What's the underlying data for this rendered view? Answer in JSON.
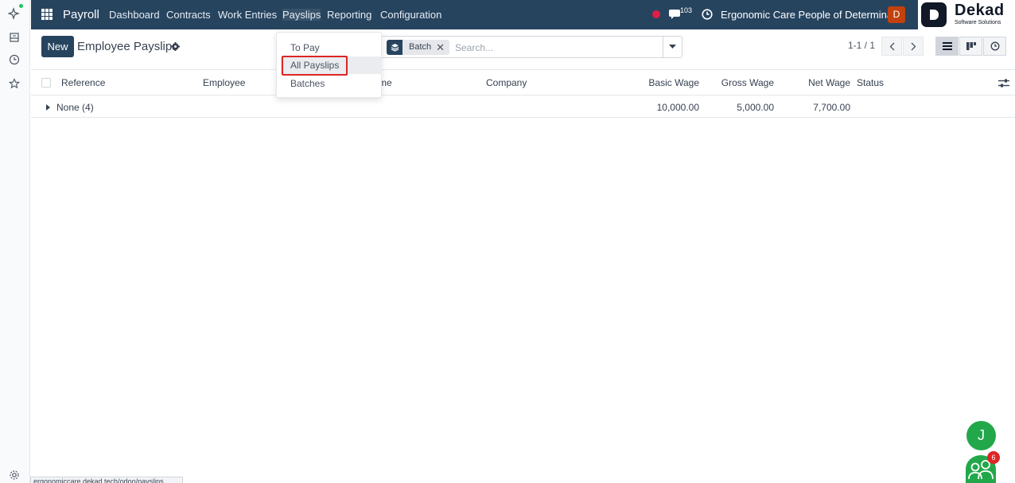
{
  "topbar": {
    "app_name": "Payroll",
    "menu": [
      "Dashboard",
      "Contracts",
      "Work Entries",
      "Payslips",
      "Reporting",
      "Configuration"
    ],
    "active_menu": "Payslips",
    "messages_count": "103",
    "company": "Ergonomic Care People of Determina...",
    "user_initial": "D",
    "colors": {
      "bar": "#27445f",
      "avatar": "#c2410c",
      "status_dot": "#e11d48"
    }
  },
  "logo": {
    "name": "Dekad",
    "tagline": "Software Solutions"
  },
  "control_panel": {
    "new_label": "New",
    "title": "Employee Payslips",
    "facet_label": "Batch",
    "facet_remove": "✕",
    "search_placeholder": "Search...",
    "pager": "1-1 / 1"
  },
  "payslips_menu": {
    "items": [
      "To Pay",
      "All Payslips",
      "Batches"
    ],
    "selected": "All Payslips"
  },
  "table": {
    "columns": {
      "reference": "Reference",
      "employee": "Employee",
      "batch_name": "me",
      "company": "Company",
      "basic_wage": "Basic Wage",
      "gross_wage": "Gross Wage",
      "net_wage": "Net Wage",
      "status": "Status"
    },
    "group": {
      "label": "None (4)",
      "basic_wage": "10,000.00",
      "gross_wage": "5,000.00",
      "net_wage": "7,700.00"
    }
  },
  "status_url": "ergonomiccare.dekad.tech/odoo/payslips",
  "chat_bubble": {
    "initial": "J",
    "livechat_count": "6",
    "color": "#22a84b"
  },
  "icons": [
    "apps-grid-icon",
    "ai-sparkle-icon",
    "inbox-icon",
    "history-clock-icon",
    "star-icon",
    "settings-gear-icon",
    "chat-icon",
    "clock-icon",
    "layers-icon",
    "caret-down-icon",
    "chevron-left-icon",
    "chevron-right-icon",
    "list-view-icon",
    "kanban-view-icon",
    "activity-view-icon",
    "column-adjust-icon"
  ]
}
